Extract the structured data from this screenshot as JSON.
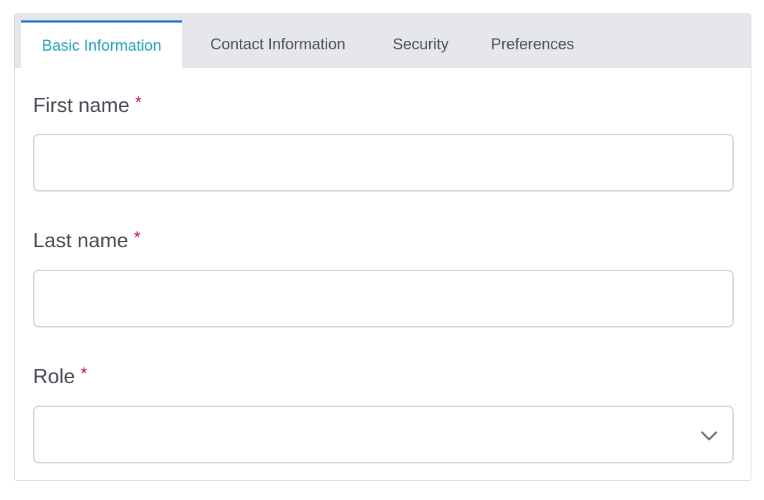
{
  "tabs": [
    {
      "label": "Basic Information",
      "active": true
    },
    {
      "label": "Contact Information",
      "active": false
    },
    {
      "label": "Security",
      "active": false
    },
    {
      "label": "Preferences",
      "active": false
    }
  ],
  "form": {
    "first_name": {
      "label": "First name",
      "required_mark": "*",
      "value": ""
    },
    "last_name": {
      "label": "Last name",
      "required_mark": "*",
      "value": ""
    },
    "role": {
      "label": "Role",
      "required_mark": "*",
      "selected": ""
    }
  },
  "icons": {
    "role_dropdown": "chevron-down-icon"
  },
  "colors": {
    "active_tab_text": "#1fa3b8",
    "active_tab_indicator": "#1a73c9",
    "required_mark": "#c8102e",
    "tabbar_background": "#e6e7ea"
  }
}
